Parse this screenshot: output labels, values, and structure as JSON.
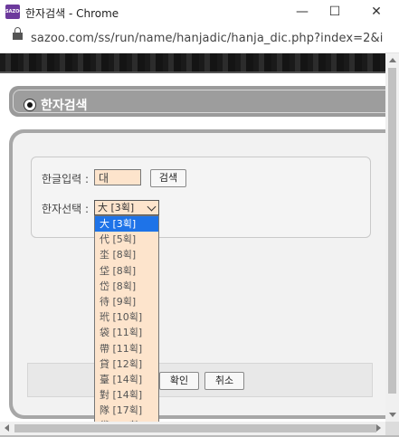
{
  "window": {
    "title": "한자검색 - Chrome",
    "app_icon_text": "SAZOO",
    "minimize_glyph": "—",
    "maximize_glyph": "☐",
    "close_glyph": "✕"
  },
  "address_bar": {
    "url": "sazoo.com/ss/run/name/hanjadic/hanja_dic.php?index=2&i"
  },
  "section": {
    "title": "한자검색"
  },
  "form": {
    "hangul_label": "한글입력 :",
    "hangul_value": "대",
    "search_button": "검색",
    "hanja_label": "한자선택 :",
    "selected_option": "大 [3획]",
    "options": [
      "大 [3획]",
      "代 [5획]",
      "坔 [8획]",
      "垈 [8획]",
      "岱 [8획]",
      "待 [9획]",
      "玳 [10획]",
      "袋 [11획]",
      "帶 [11획]",
      "貸 [12획]",
      "臺 [14획]",
      "對 [14획]",
      "隊 [17획]",
      "黛 [17획]"
    ]
  },
  "actions": {
    "ok_button": "확인",
    "cancel_button": "취소"
  },
  "colors": {
    "input_bg": "#fde4cc",
    "selected_option_bg": "#1e73e8",
    "header_gray": "#9d9d9d"
  }
}
